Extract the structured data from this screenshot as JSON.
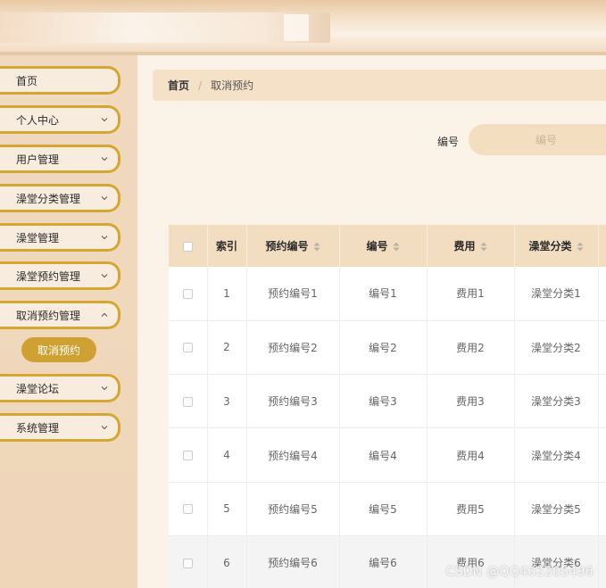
{
  "sidebar": {
    "items": [
      {
        "label": "首页",
        "has_arrow": false
      },
      {
        "label": "个人中心",
        "has_arrow": true
      },
      {
        "label": "用户管理",
        "has_arrow": true
      },
      {
        "label": "澡堂分类管理",
        "has_arrow": true
      },
      {
        "label": "澡堂管理",
        "has_arrow": true
      },
      {
        "label": "澡堂预约管理",
        "has_arrow": true
      },
      {
        "label": "取消预约管理",
        "has_arrow": true
      },
      {
        "label": "澡堂论坛",
        "has_arrow": true
      },
      {
        "label": "系统管理",
        "has_arrow": true
      }
    ],
    "active_submenu": "取消预约"
  },
  "breadcrumb": {
    "home": "首页",
    "separator": "/",
    "current": "取消预约"
  },
  "search": {
    "label": "编号",
    "placeholder": "编号",
    "value": ""
  },
  "table": {
    "columns": [
      "索引",
      "预约编号",
      "编号",
      "费用",
      "澡堂分类"
    ],
    "rows": [
      {
        "index": "1",
        "booking_no": "预约编号1",
        "no": "编号1",
        "fee": "费用1",
        "category": "澡堂分类1"
      },
      {
        "index": "2",
        "booking_no": "预约编号2",
        "no": "编号2",
        "fee": "费用2",
        "category": "澡堂分类2"
      },
      {
        "index": "3",
        "booking_no": "预约编号3",
        "no": "编号3",
        "fee": "费用3",
        "category": "澡堂分类3"
      },
      {
        "index": "4",
        "booking_no": "预约编号4",
        "no": "编号4",
        "fee": "费用4",
        "category": "澡堂分类4"
      },
      {
        "index": "5",
        "booking_no": "预约编号5",
        "no": "编号5",
        "fee": "费用5",
        "category": "澡堂分类5"
      },
      {
        "index": "6",
        "booking_no": "预约编号6",
        "no": "编号6",
        "fee": "费用6",
        "category": "澡堂分类6"
      }
    ]
  },
  "watermark": "CSDN @QQ402205496",
  "colors": {
    "accent": "#d4a732",
    "submenu_button": "#cfa132",
    "header_bg": "#f3ddc0",
    "sidebar_bg": "#f0d9bf"
  }
}
